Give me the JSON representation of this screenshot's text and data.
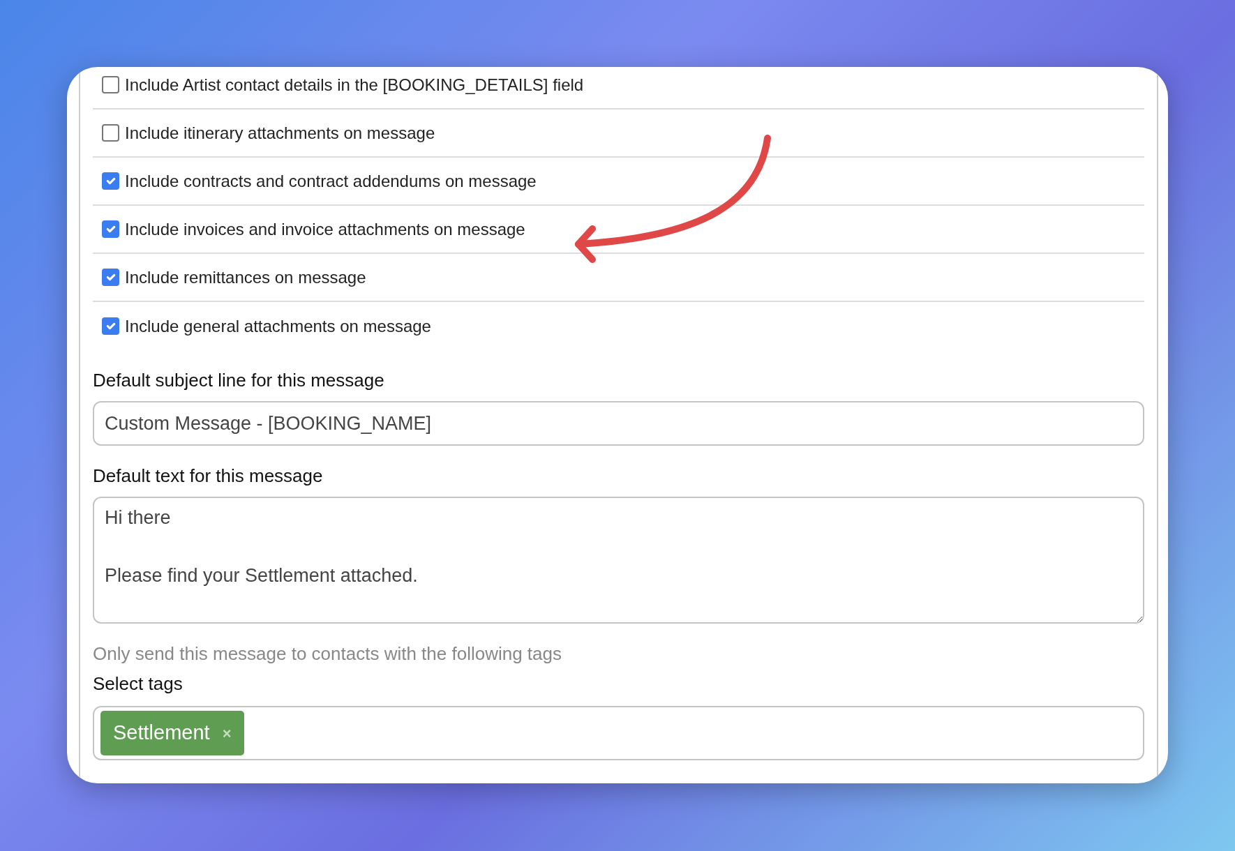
{
  "options": [
    {
      "label": "Include Artist contact details in the [BOOKING_DETAILS] field",
      "checked": false
    },
    {
      "label": "Include itinerary attachments on message",
      "checked": false
    },
    {
      "label": "Include contracts and contract addendums on message",
      "checked": true
    },
    {
      "label": "Include invoices and invoice attachments on message",
      "checked": true
    },
    {
      "label": "Include remittances on message",
      "checked": true
    },
    {
      "label": "Include general attachments on message",
      "checked": true
    }
  ],
  "subject": {
    "label": "Default subject line for this message",
    "value": "Custom Message - [BOOKING_NAME]"
  },
  "message": {
    "label": "Default text for this message",
    "value": "Hi there\n\nPlease find your Settlement attached."
  },
  "tags": {
    "hint": "Only send this message to contacts with the following tags",
    "label": "Select tags",
    "selected": [
      {
        "label": "Settlement",
        "remove": "×"
      }
    ]
  }
}
